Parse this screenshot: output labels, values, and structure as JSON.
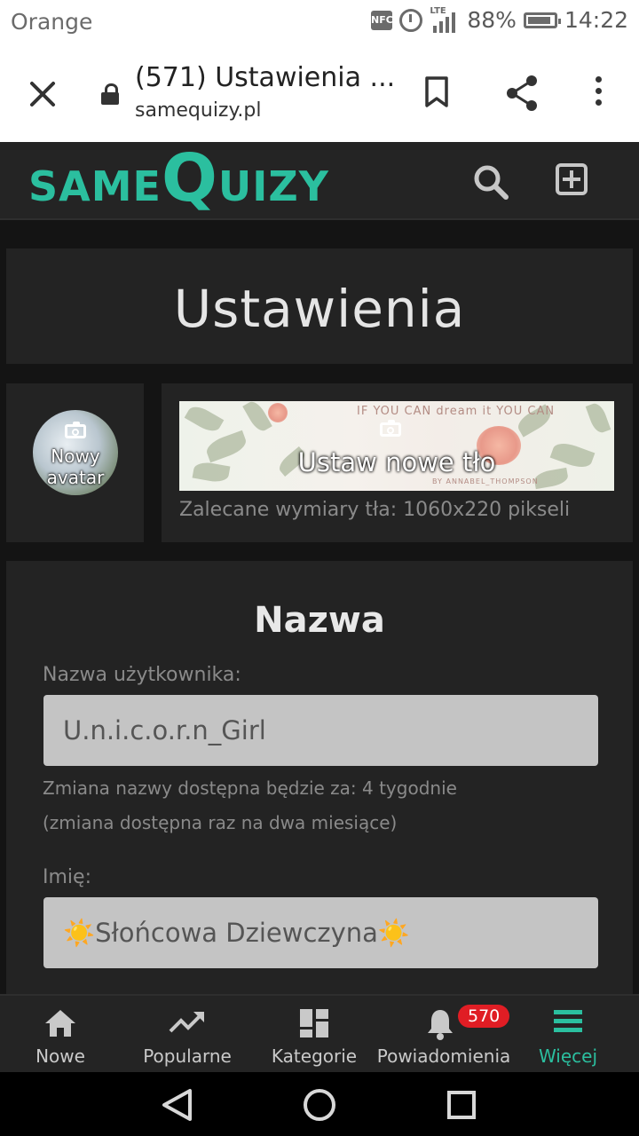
{
  "status_bar": {
    "carrier": "Orange",
    "nfc": "NFC",
    "network": "LTE",
    "battery": "88%",
    "battery_level": 0.88,
    "time": "14:22"
  },
  "browser": {
    "tab_title": "(571) Ustawienia ...",
    "url": "samequizy.pl"
  },
  "site": {
    "logo_part1": "same",
    "logo_part2": "Q",
    "logo_part3": "uizy",
    "brand_color": "#2bbf9f"
  },
  "settings": {
    "page_title": "Ustawienia",
    "avatar_label": "Nowy avatar",
    "banner_label": "Ustaw nowe tło",
    "banner_art_text": "IF YOU CAN dream it YOU CAN",
    "banner_art_credit": "BY ANNABEL_THOMPSON",
    "banner_hint": "Zalecane wymiary tła: 1060x220 pikseli"
  },
  "name_section": {
    "heading": "Nazwa",
    "username_label": "Nazwa użytkownika:",
    "username_value": "U.n.i.c.o.r.n_Girl",
    "change_note": "Zmiana nazwy dostępna będzie za: 4 tygodnie",
    "change_note2": "(zmiana dostępna raz na dwa miesiące)",
    "firstname_label": "Imię:",
    "firstname_value": "☀️Słońcowa Dziewczyna☀️"
  },
  "bottom_nav": {
    "items": [
      {
        "label": "Nowe",
        "icon": "home-icon"
      },
      {
        "label": "Popularne",
        "icon": "trending-icon"
      },
      {
        "label": "Kategorie",
        "icon": "categories-icon"
      },
      {
        "label": "Powiadomienia",
        "icon": "bell-icon",
        "badge": "570"
      },
      {
        "label": "Więcej",
        "icon": "menu-icon",
        "active": true
      }
    ]
  }
}
